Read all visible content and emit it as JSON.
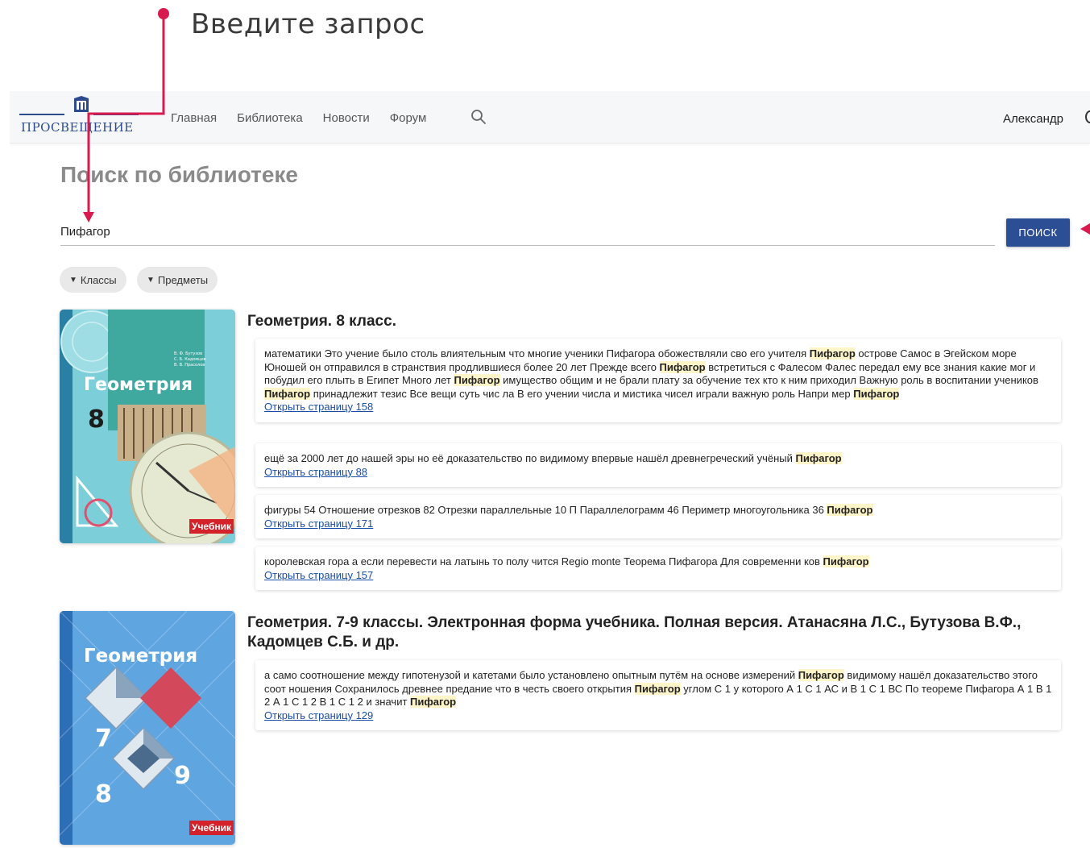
{
  "annotation": {
    "text": "Введите запрос"
  },
  "header": {
    "logo_text": "ПРОСВЕЩЕНИЕ",
    "nav": [
      "Главная",
      "Библиотека",
      "Новости",
      "Форум"
    ],
    "user_name": "Александр"
  },
  "page": {
    "title": "Поиск по библиотеке"
  },
  "search": {
    "value": "Пифагор",
    "button_label": "поиск"
  },
  "filters": [
    {
      "label": "Классы"
    },
    {
      "label": "Предметы"
    }
  ],
  "results": [
    {
      "title": "Геометрия. 8 класс.",
      "cover": {
        "title": "Геометрия",
        "grade": "8",
        "label": "Учебник",
        "authors": "В. Ф. Бутузов\nС. Б. Кадомцев\nВ. В. Прасолов"
      },
      "snippets": [
        {
          "parts": [
            {
              "t": "математики Это учение было столь влиятельным что многие ученики Пифагора обожествляли сво его учителя "
            },
            {
              "t": "Пифагор",
              "hl": true
            },
            {
              "t": " острове Самос в Эгейском море Юношей он отправился в странствия продлившиеся более 20 лет Прежде всего "
            },
            {
              "t": "Пифагор",
              "hl": true
            },
            {
              "t": " встретиться с Фалесом Фалес передал ему все знания какие мог и побудил его плыть в Египет Много лет "
            },
            {
              "t": "Пифагор",
              "hl": true
            },
            {
              "t": " имущество общим и не брали плату за обучение тех кто к ним приходил Важную роль в воспитании учеников "
            },
            {
              "t": "Пифагор",
              "hl": true
            },
            {
              "t": " принадлежит тезис Все вещи суть чис ла В его учении числа и мистика чисел играли важную роль Напри мер "
            },
            {
              "t": "Пифагор",
              "hl": true
            }
          ],
          "link": "Открыть страницу 158"
        },
        {
          "parts": [
            {
              "t": "ещё за 2000 лет до нашей эры но её доказательство по видимому впервые нашёл древнегреческий учёный "
            },
            {
              "t": "Пифагор",
              "hl": true
            }
          ],
          "link": "Открыть страницу 88"
        },
        {
          "parts": [
            {
              "t": "фигуры 54 Отношение отрезков 82 Отрезки параллельные 10 П Параллелограмм 46 Периметр многоугольника 36 "
            },
            {
              "t": "Пифагор",
              "hl": true
            }
          ],
          "link": "Открыть страницу 171"
        },
        {
          "parts": [
            {
              "t": "королевская гора а если перевести на латынь то полу чится Regio monte Теорема Пифагора Для современни ков "
            },
            {
              "t": "Пифагор",
              "hl": true
            }
          ],
          "link": "Открыть страницу 157"
        }
      ]
    },
    {
      "title": "Геометрия. 7-9 классы. Электронная форма учебника. Полная версия. Атанасяна Л.С., Бутузова В.Ф., Кадомцев С.Б. и др.",
      "cover": {
        "title": "Геометрия",
        "grade_a": "7",
        "grade_b": "8",
        "grade_c": "9",
        "label": "Учебник"
      },
      "snippets": [
        {
          "parts": [
            {
              "t": "а само соотношение между гипотенузой и катетами было установлено опытным путём на основе измерений "
            },
            {
              "t": "Пифагор",
              "hl": true
            },
            {
              "t": " видимому нашёл доказательство этого соот ношения Сохранилось древнее предание что в честь своего открытия "
            },
            {
              "t": "Пифагор",
              "hl": true
            },
            {
              "t": " углом С 1 у которого А 1 С 1 АС и В 1 С 1 ВС По теореме Пифагора А 1 В 1 2 А 1 С 1 2 В 1 С 1 2 и значит "
            },
            {
              "t": "Пифагор",
              "hl": true
            }
          ],
          "link": "Открыть страницу 129"
        }
      ]
    }
  ]
}
